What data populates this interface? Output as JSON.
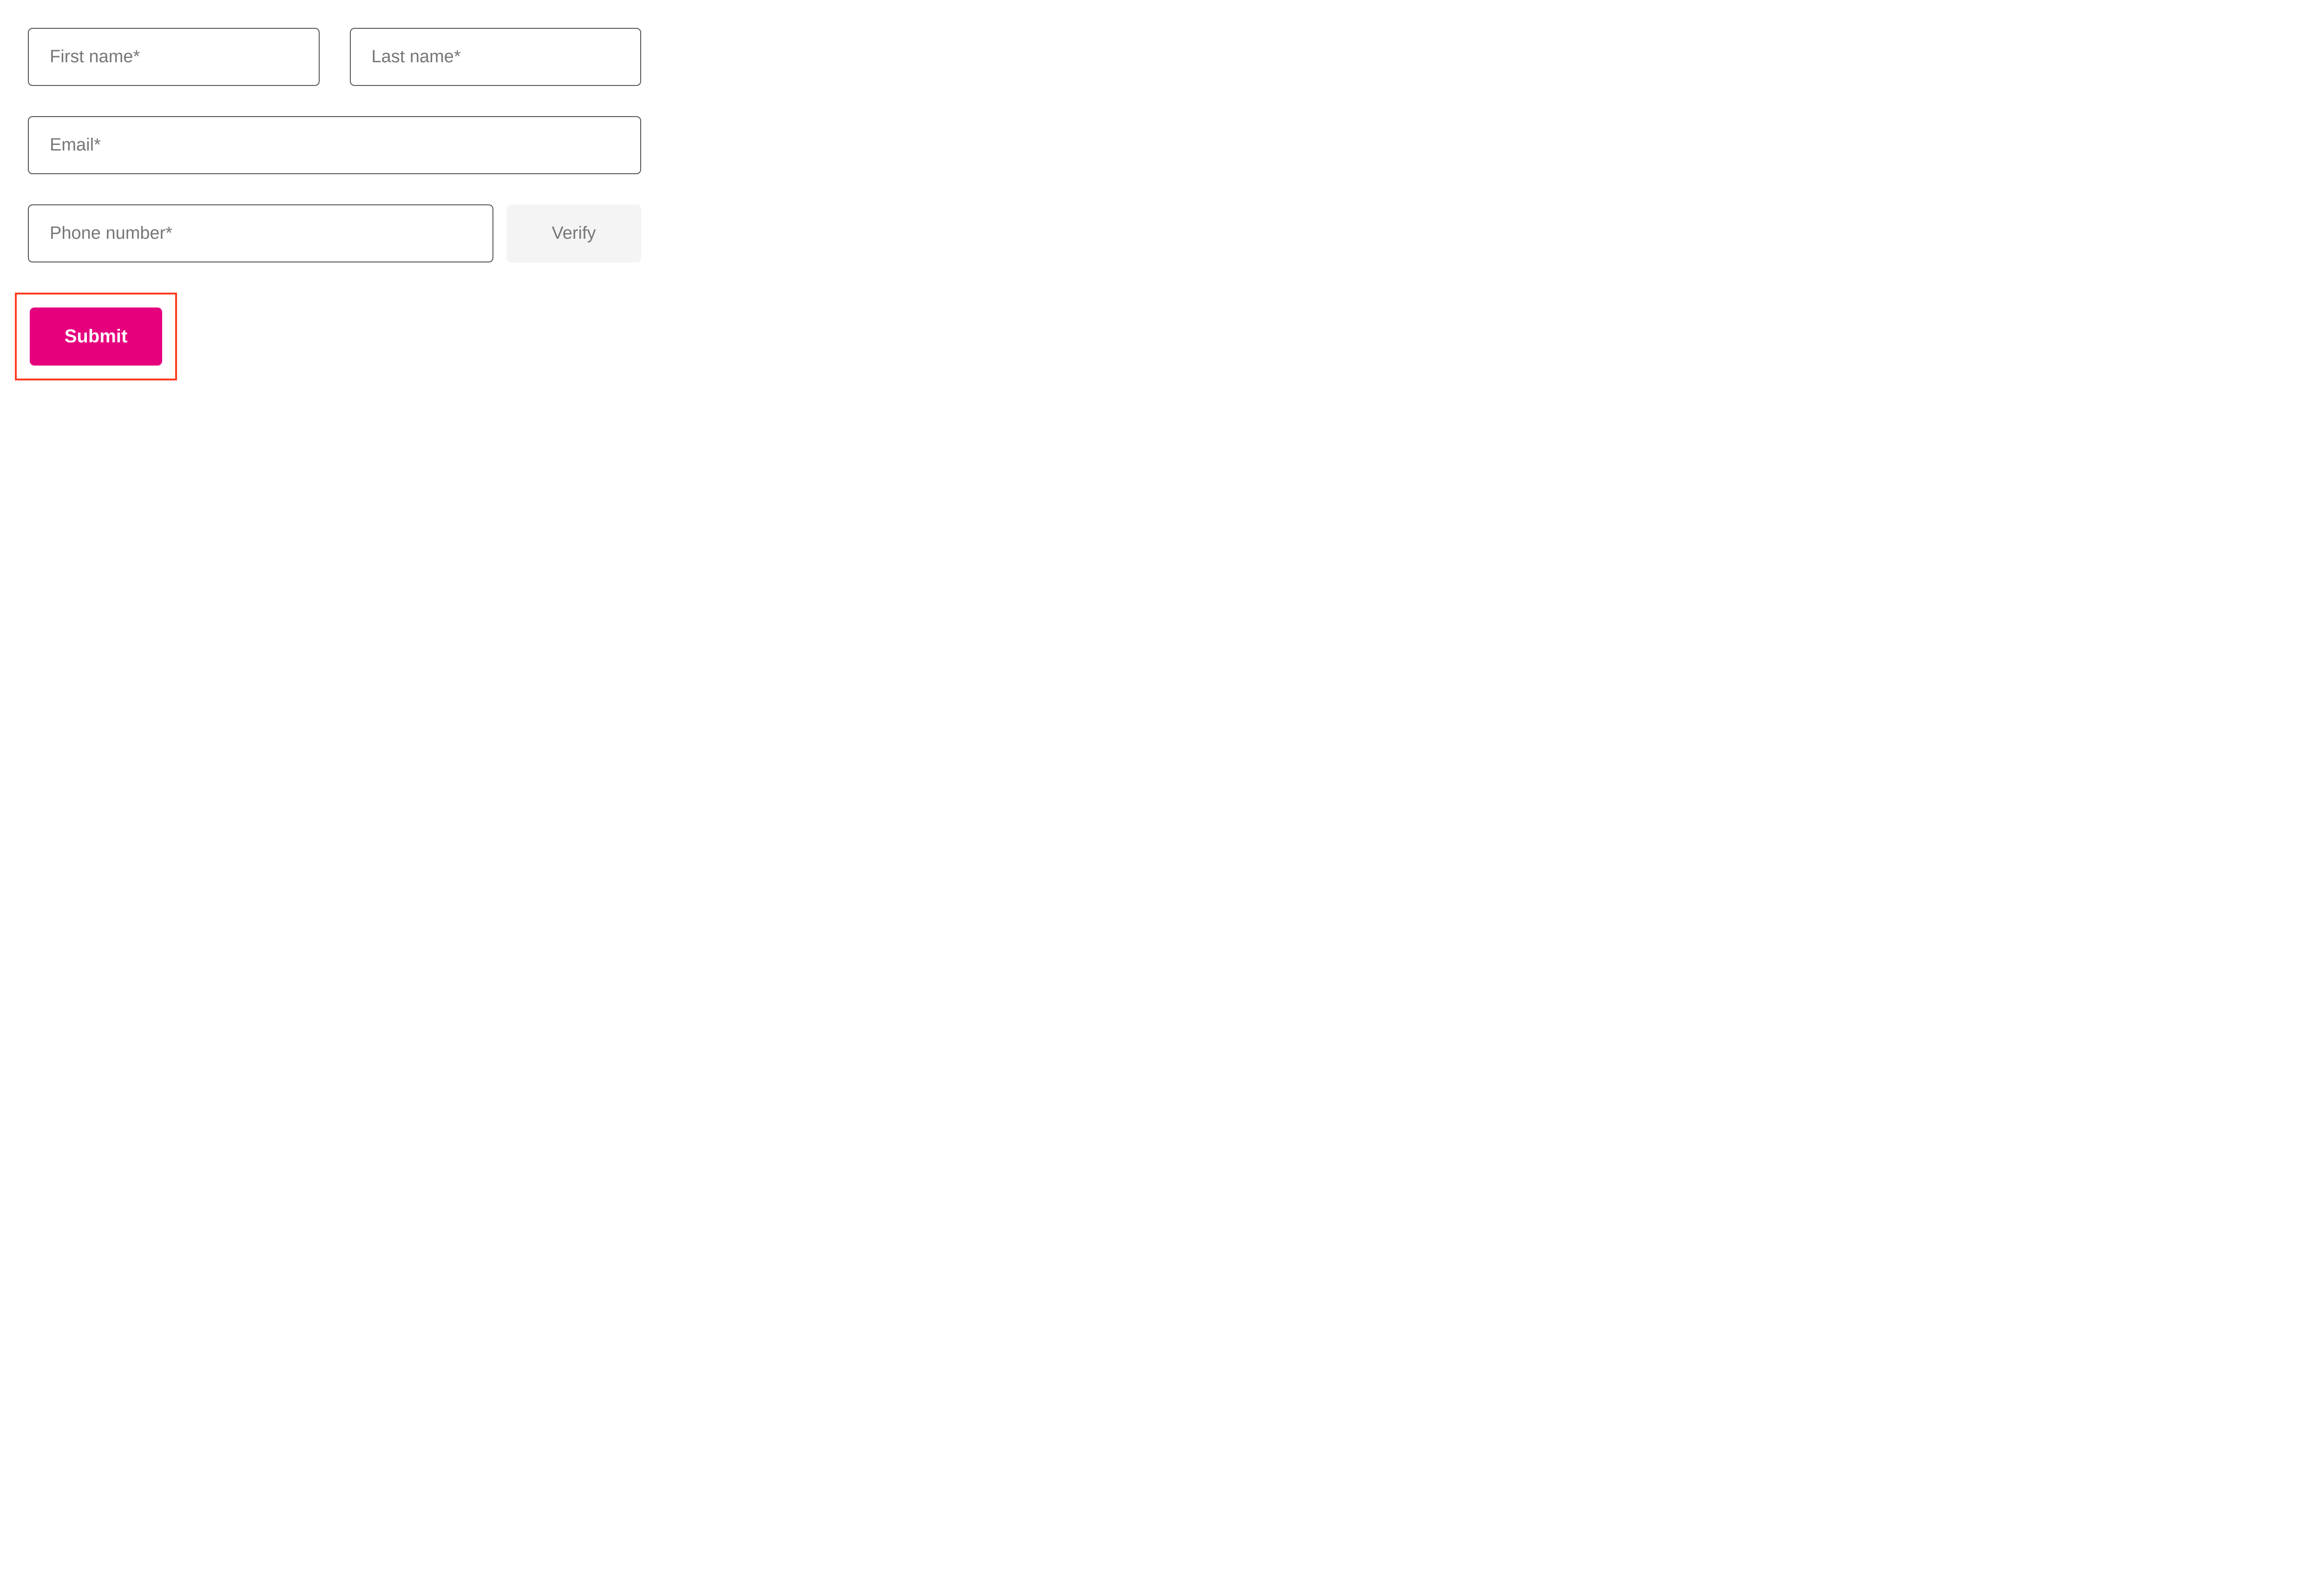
{
  "form": {
    "first_name": {
      "placeholder": "First name*",
      "value": ""
    },
    "last_name": {
      "placeholder": "Last name*",
      "value": ""
    },
    "email": {
      "placeholder": "Email*",
      "value": ""
    },
    "phone": {
      "placeholder": "Phone number*",
      "value": ""
    },
    "verify_label": "Verify",
    "submit_label": "Submit"
  },
  "colors": {
    "accent": "#e6007e",
    "highlight_border": "#ff3b1f",
    "input_border": "#555555",
    "placeholder": "#777777",
    "verify_bg": "#f4f4f4"
  }
}
